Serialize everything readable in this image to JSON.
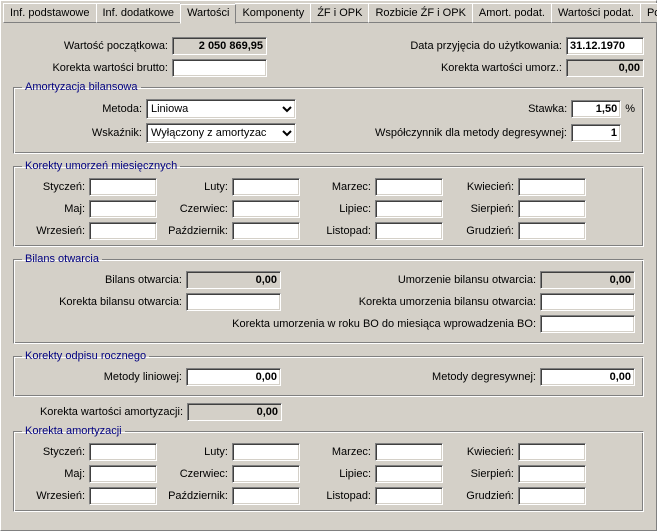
{
  "tabs": {
    "t0": "Inf. podstawowe",
    "t1": "Inf. dodatkowe",
    "t2": "Wartości",
    "t3": "Komponenty",
    "t4": "ŹF i OPK",
    "t5": "Rozbicie ŹF i OPK",
    "t6": "Amort. podat.",
    "t7": "Wartości podat.",
    "t8": "Potencjały"
  },
  "top": {
    "initial_value_label": "Wartość początkowa:",
    "initial_value": "2 050 869,95",
    "date_label": "Data przyjęcia do użytkowania:",
    "date_value": "31.12.1970",
    "gross_corr_label": "Korekta wartości brutto:",
    "gross_corr_value": "",
    "depr_corr_label": "Korekta wartości umorz.:",
    "depr_corr_value": "0,00"
  },
  "amort": {
    "legend": "Amortyzacja bilansowa",
    "method_label": "Metoda:",
    "method_value": "Liniowa",
    "indicator_label": "Wskaźnik:",
    "indicator_value": "Wyłączony z amortyzac",
    "rate_label": "Stawka:",
    "rate_value": "1,50",
    "rate_suffix": "%",
    "degr_label": "Współczynnik dla metody degresywnej:",
    "degr_value": "1"
  },
  "months_labels": {
    "jan": "Styczeń:",
    "feb": "Luty:",
    "mar": "Marzec:",
    "apr": "Kwiecień:",
    "may": "Maj:",
    "jun": "Czerwiec:",
    "jul": "Lipiec:",
    "aug": "Sierpień:",
    "sep": "Wrzesień:",
    "oct": "Październik:",
    "nov": "Listopad:",
    "dec": "Grudzień:"
  },
  "korum": {
    "legend": "Korekty umorzeń miesięcznych"
  },
  "bilans": {
    "legend": "Bilans otwarcia",
    "bo_label": "Bilans otwarcia:",
    "bo_value": "0,00",
    "umbo_label": "Umorzenie bilansu otwarcia:",
    "umbo_value": "0,00",
    "kbo_label": "Korekta bilansu otwarcia:",
    "kbo_value": "",
    "kumbo_label": "Korekta umorzenia bilansu otwarcia:",
    "kumbo_value": "",
    "long_label": "Korekta umorzenia w  roku BO do miesiąca wprowadzenia BO:",
    "long_value": ""
  },
  "odpis": {
    "legend": "Korekty odpisu rocznego",
    "lin_label": "Metody liniowej:",
    "lin_value": "0,00",
    "deg_label": "Metody degresywnej:",
    "deg_value": "0,00"
  },
  "kwa": {
    "label": "Korekta wartości amortyzacji:",
    "value": "0,00"
  },
  "koram": {
    "legend": "Korekta amortyzacji"
  }
}
